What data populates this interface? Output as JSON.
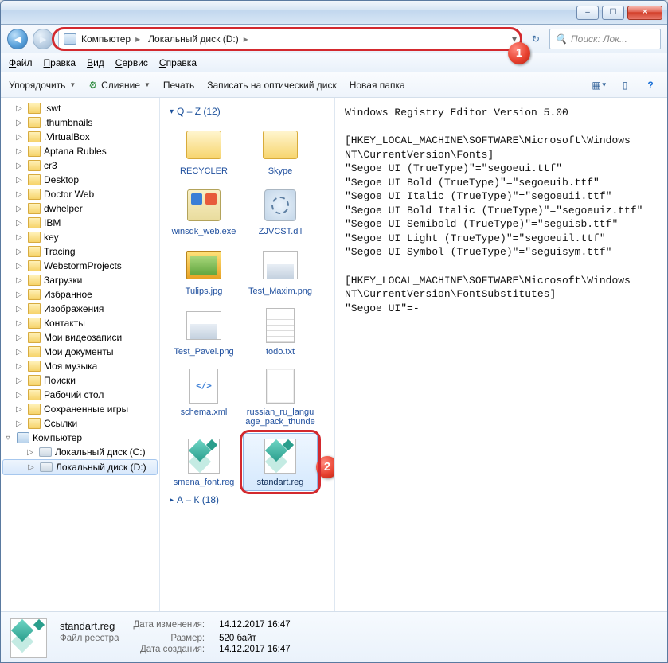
{
  "titlebar": {
    "min": "–",
    "max": "☐",
    "close": "✕"
  },
  "nav": {
    "breadcrumb": [
      "Компьютер",
      "Локальный диск (D:)"
    ],
    "search_placeholder": "Поиск: Лок...",
    "refresh_icon": "↻"
  },
  "menubar": [
    "Файл",
    "Правка",
    "Вид",
    "Сервис",
    "Справка"
  ],
  "toolbar": {
    "organize": "Упорядочить",
    "merge": "Слияние",
    "print": "Печать",
    "burn": "Записать на оптический диск",
    "newfolder": "Новая папка"
  },
  "callouts": {
    "one": "1",
    "two": "2"
  },
  "tree": {
    "items": [
      {
        "label": ".swt",
        "type": "folder"
      },
      {
        "label": ".thumbnails",
        "type": "folder"
      },
      {
        "label": ".VirtualBox",
        "type": "folder"
      },
      {
        "label": "Aptana Rubles",
        "type": "folder"
      },
      {
        "label": "cr3",
        "type": "folder"
      },
      {
        "label": "Desktop",
        "type": "folder"
      },
      {
        "label": "Doctor Web",
        "type": "folder"
      },
      {
        "label": "dwhelper",
        "type": "folder"
      },
      {
        "label": "IBM",
        "type": "folder"
      },
      {
        "label": "key",
        "type": "folder"
      },
      {
        "label": "Tracing",
        "type": "folder"
      },
      {
        "label": "WebstormProjects",
        "type": "folder"
      },
      {
        "label": "Загрузки",
        "type": "folder"
      },
      {
        "label": "Избранное",
        "type": "folder"
      },
      {
        "label": "Изображения",
        "type": "folder"
      },
      {
        "label": "Контакты",
        "type": "folder"
      },
      {
        "label": "Мои видеозаписи",
        "type": "folder"
      },
      {
        "label": "Мои документы",
        "type": "folder"
      },
      {
        "label": "Моя музыка",
        "type": "folder"
      },
      {
        "label": "Поиски",
        "type": "folder"
      },
      {
        "label": "Рабочий стол",
        "type": "folder"
      },
      {
        "label": "Сохраненные игры",
        "type": "folder"
      },
      {
        "label": "Ссылки",
        "type": "folder"
      }
    ],
    "computer": "Компьютер",
    "drives": [
      {
        "label": "Локальный диск (C:)"
      },
      {
        "label": "Локальный диск (D:)",
        "selected": true
      }
    ]
  },
  "groups": {
    "g1": {
      "header": "Q – Z (12)"
    },
    "g2": {
      "header": "А – К (18)"
    }
  },
  "files": [
    {
      "label": "RECYCLER",
      "icon": "folder"
    },
    {
      "label": "Skype",
      "icon": "folder"
    },
    {
      "label": "winsdk_web.exe",
      "icon": "exe"
    },
    {
      "label": "ZJVCST.dll",
      "icon": "dll"
    },
    {
      "label": "Tulips.jpg",
      "icon": "img"
    },
    {
      "label": "Test_Maxim.png",
      "icon": "png"
    },
    {
      "label": "Test_Pavel.png",
      "icon": "png"
    },
    {
      "label": "todo.txt",
      "icon": "txt"
    },
    {
      "label": "schema.xml",
      "icon": "xml"
    },
    {
      "label": "russian_ru_language_pack_thunde",
      "icon": "doc"
    },
    {
      "label": "smena_font.reg",
      "icon": "reg"
    },
    {
      "label": "standart.reg",
      "icon": "reg",
      "selected": true
    }
  ],
  "preview_text": "Windows Registry Editor Version 5.00\n\n[HKEY_LOCAL_MACHINE\\SOFTWARE\\Microsoft\\Windows NT\\CurrentVersion\\Fonts]\n\"Segoe UI (TrueType)\"=\"segoeui.ttf\"\n\"Segoe UI Bold (TrueType)\"=\"segoeuib.ttf\"\n\"Segoe UI Italic (TrueType)\"=\"segoeuii.ttf\"\n\"Segoe UI Bold Italic (TrueType)\"=\"segoeuiz.ttf\"\n\"Segoe UI Semibold (TrueType)\"=\"seguisb.ttf\"\n\"Segoe UI Light (TrueType)\"=\"segoeuil.ttf\"\n\"Segoe UI Symbol (TrueType)\"=\"seguisym.ttf\"\n\n[HKEY_LOCAL_MACHINE\\SOFTWARE\\Microsoft\\Windows NT\\CurrentVersion\\FontSubstitutes]\n\"Segoe UI\"=-",
  "details": {
    "filename": "standart.reg",
    "filetype": "Файл реестра",
    "k_modified": "Дата изменения:",
    "v_modified": "14.12.2017 16:47",
    "k_size": "Размер:",
    "v_size": "520 байт",
    "k_created": "Дата создания:",
    "v_created": "14.12.2017 16:47"
  }
}
